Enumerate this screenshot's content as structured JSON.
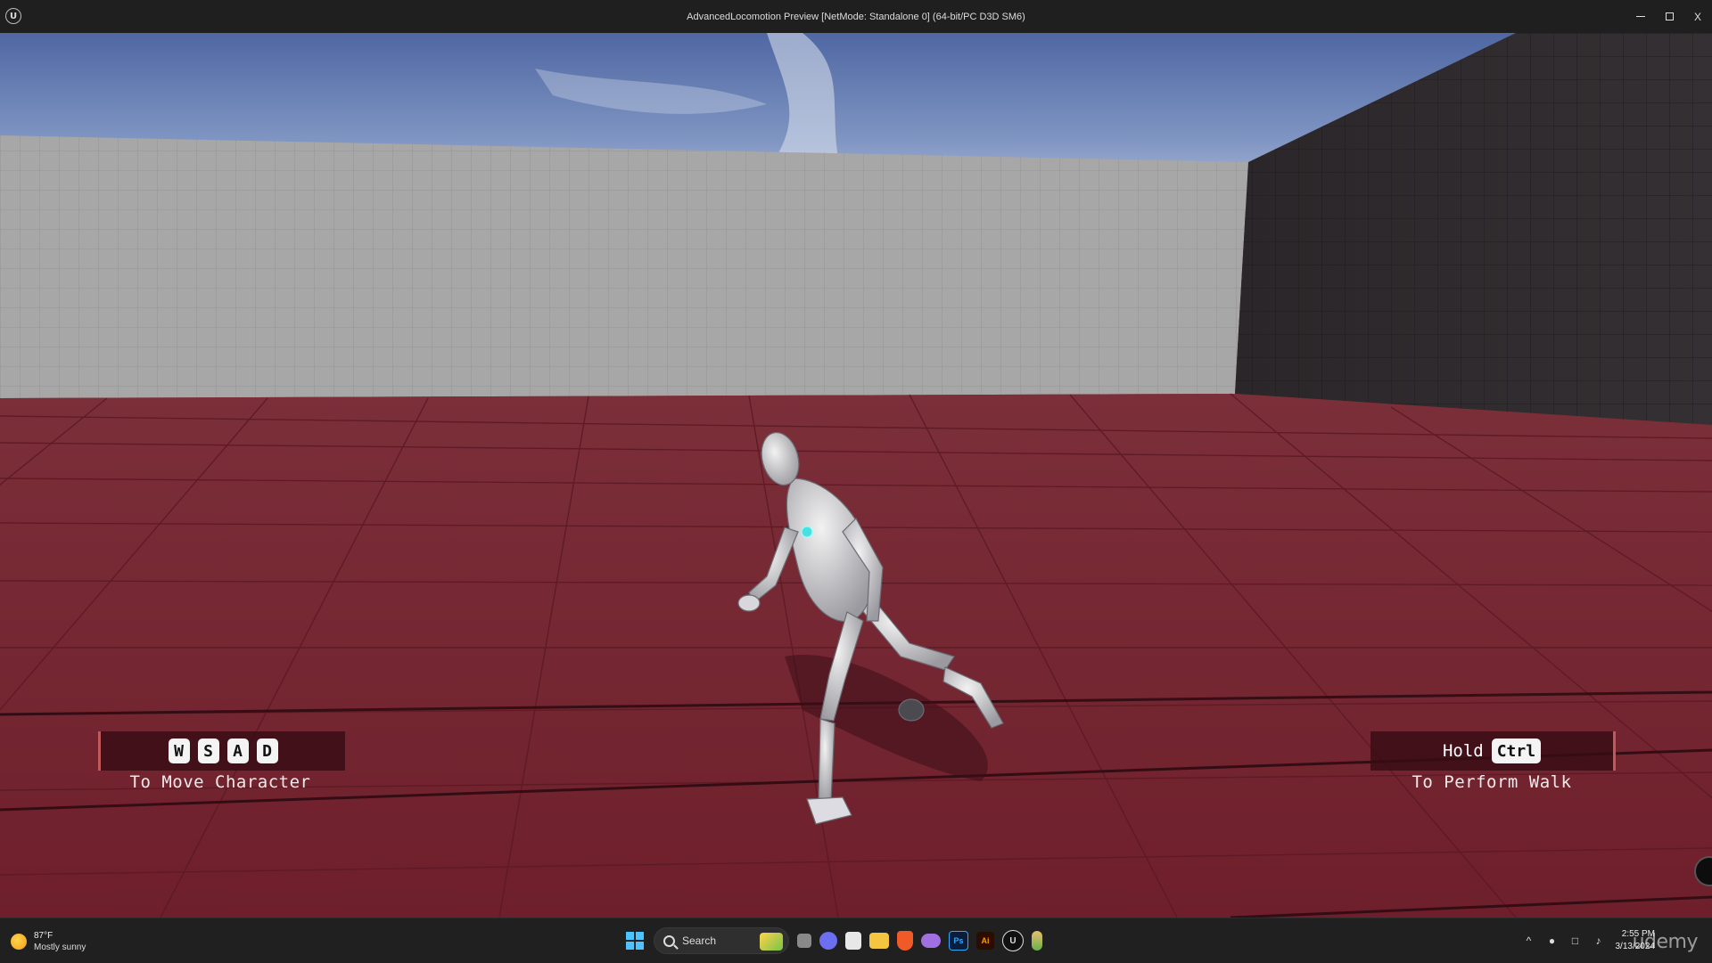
{
  "window": {
    "title": "AdvancedLocomotion Preview [NetMode: Standalone 0]  (64-bit/PC D3D SM6)",
    "logo_icon": "unreal-engine-icon",
    "controls": [
      "minimize",
      "maximize",
      "close"
    ],
    "close_label": "X"
  },
  "hud": {
    "move_keys": [
      "W",
      "S",
      "A",
      "D"
    ],
    "move_caption": "To Move Character",
    "walk_hold_label": "Hold",
    "walk_key": "Ctrl",
    "walk_caption": "To Perform Walk"
  },
  "taskbar": {
    "weather_temp": "87°F",
    "weather_desc": "Mostly sunny",
    "search_label": "Search",
    "apps": [
      "task-view",
      "chat",
      "store",
      "file-explorer",
      "brave",
      "game",
      "photoshop",
      "illustrator",
      "unreal-engine",
      "extra-app"
    ],
    "clock_time": "2:55 PM",
    "clock_date": "3/13/2024",
    "watermark": "udemy"
  },
  "colors": {
    "floor": "#7a2632",
    "sky": "#6f86b8",
    "wall_light": "#a5a5a5",
    "wall_dark": "#2d2b2e",
    "hud_bg": "#3a0e16",
    "accent": "#4cc2ff"
  }
}
